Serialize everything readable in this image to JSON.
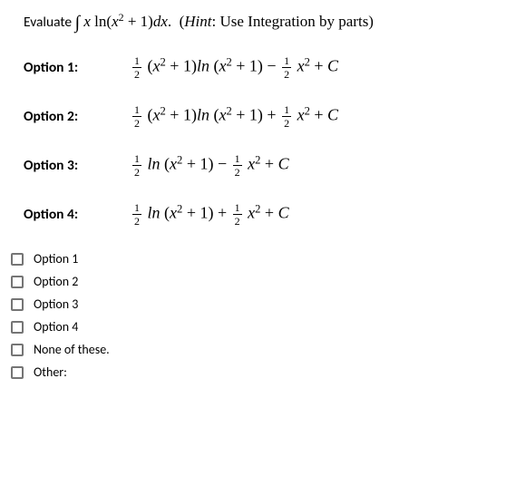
{
  "question": {
    "prefix": "Evaluate ",
    "integral_html": "∫ 𝑥 ln(𝑥² + 1)d𝑥.  ",
    "hint": "(𝐻𝑖𝑛𝑡: Use Integration by parts)"
  },
  "options": [
    {
      "label": "Option 1:",
      "frac1_num": "1",
      "frac1_den": "2",
      "body1": " (𝑥² + 1)𝑙𝑛 (𝑥² + 1) − ",
      "frac2_num": "1",
      "frac2_den": "2",
      "body2": " 𝑥² + 𝐶"
    },
    {
      "label": "Option 2:",
      "frac1_num": "1",
      "frac1_den": "2",
      "body1": " (𝑥² + 1)𝑙𝑛 (𝑥² + 1) + ",
      "frac2_num": "1",
      "frac2_den": "2",
      "body2": " 𝑥² + 𝐶"
    },
    {
      "label": "Option 3:",
      "frac1_num": "1",
      "frac1_den": "2",
      "body1": " 𝑙𝑛 (𝑥² + 1) − ",
      "frac2_num": "1",
      "frac2_den": "2",
      "body2": " 𝑥² + 𝐶"
    },
    {
      "label": "Option 4:",
      "frac1_num": "1",
      "frac1_den": "2",
      "body1": " 𝑙𝑛 (𝑥² + 1) + ",
      "frac2_num": "1",
      "frac2_den": "2",
      "body2": " 𝑥² + 𝐶"
    }
  ],
  "answers": [
    "Option 1",
    "Option 2",
    "Option 3",
    "Option 4",
    "None of these.",
    "Other:"
  ]
}
